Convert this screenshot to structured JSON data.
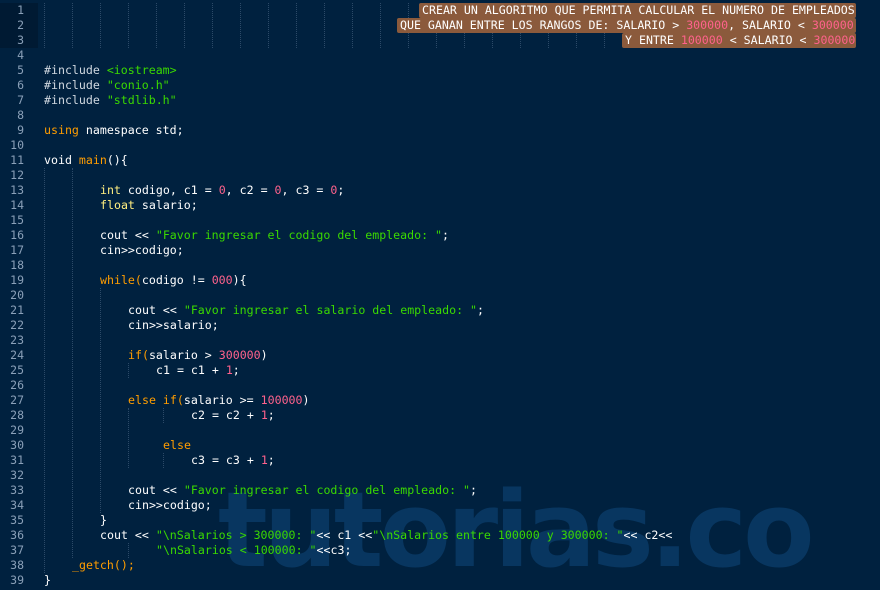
{
  "editor": {
    "theme_colors": {
      "background": "#00213f",
      "keyword": "#ff9d00",
      "type": "#ffee80",
      "string": "#3ad900",
      "number": "#ff628c",
      "selection": "#8b5a3c"
    },
    "line_numbers": [
      "1",
      "2",
      "3",
      "4",
      "5",
      "6",
      "7",
      "8",
      "9",
      "10",
      "11",
      "12",
      "13",
      "14",
      "15",
      "16",
      "17",
      "18",
      "19",
      "20",
      "21",
      "22",
      "23",
      "24",
      "25",
      "26",
      "27",
      "28",
      "29",
      "30",
      "31",
      "32",
      "33",
      "34",
      "35",
      "36",
      "37",
      "38",
      "39"
    ],
    "selected_comment": {
      "line1": "CREAR UN ALGORITMO QUE PERMITA CALCULAR EL NUMERO DE EMPLEADOS",
      "line2_a": "QUE GANAN ENTRE LOS RANGOS DE: SALARIO > ",
      "line2_n1": "300000",
      "line2_b": ", SALARIO < ",
      "line2_n2": "300000",
      "line3_a": "Y ENTRE ",
      "line3_n1": "100000",
      "line3_b": " < SALARIO < ",
      "line3_n2": "300000"
    },
    "code": {
      "l5_a": "#include ",
      "l5_b": "<iostream>",
      "l6_a": "#include ",
      "l6_b": "\"conio.h\"",
      "l7_a": "#include ",
      "l7_b": "\"stdlib.h\"",
      "l9_a": "using",
      "l9_b": " namespace std;",
      "l11_a": "void ",
      "l11_b": "main",
      "l11_c": "(){",
      "l13_a": "int",
      "l13_b": " codigo, c1 = ",
      "l13_c": "0",
      "l13_d": ", c2 = ",
      "l13_e": "0",
      "l13_f": ", c3 = ",
      "l13_g": "0",
      "l13_h": ";",
      "l14_a": "float",
      "l14_b": " salario;",
      "l16_a": "cout << ",
      "l16_b": "\"Favor ingresar el codigo del empleado: \"",
      "l16_c": ";",
      "l17": "cin>>codigo;",
      "l19_a": "while(",
      "l19_b": "codigo != ",
      "l19_c": "000",
      "l19_d": "){",
      "l21_a": "cout << ",
      "l21_b": "\"Favor ingresar el salario del empleado: \"",
      "l21_c": ";",
      "l22": "cin>>salario;",
      "l24_a": "if(",
      "l24_b": "salario > ",
      "l24_c": "300000",
      "l24_d": ")",
      "l25_a": "c1 = c1 + ",
      "l25_b": "1",
      "l25_c": ";",
      "l27_a": "else if(",
      "l27_b": "salario >= ",
      "l27_c": "100000",
      "l27_d": ")",
      "l28_a": "c2 = c2 + ",
      "l28_b": "1",
      "l28_c": ";",
      "l30": "else",
      "l31_a": "c3 = c3 + ",
      "l31_b": "1",
      "l31_c": ";",
      "l33_a": "cout << ",
      "l33_b": "\"Favor ingresar el codigo del empleado: \"",
      "l33_c": ";",
      "l34": "cin>>codigo;",
      "l35": "}",
      "l36_a": "cout << ",
      "l36_b": "\"\\nSalarios > 300000: \"",
      "l36_c": "<< c1 <<",
      "l36_d": "\"\\nSalarios entre 100000 y 300000: \"",
      "l36_e": "<< c2<<",
      "l37_a": "\"\\nSalarios < 100000: \"",
      "l37_b": "<<c3;",
      "l38_a": "_getch",
      "l38_b": "();",
      "l39": "}"
    }
  },
  "watermark": "tutorias.co"
}
